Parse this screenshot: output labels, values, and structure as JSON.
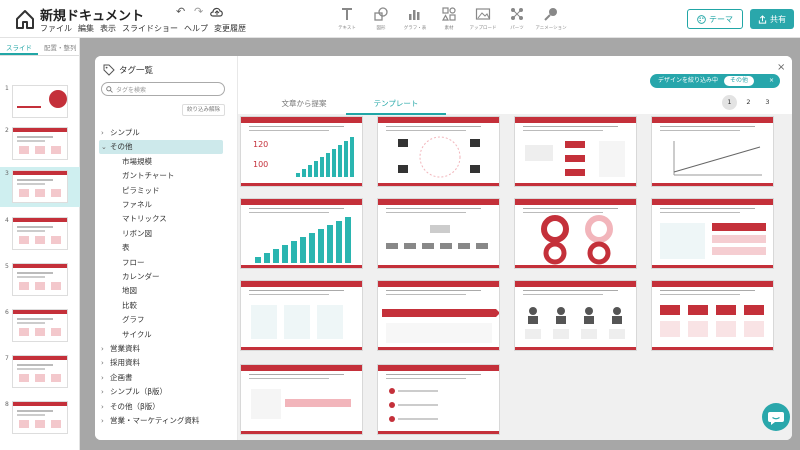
{
  "header": {
    "title": "新規ドキュメント",
    "menu": [
      "ファイル",
      "編集",
      "表示",
      "スライドショー",
      "ヘルプ",
      "変更履歴"
    ],
    "undo": "↶",
    "redo": "↷",
    "tools": [
      {
        "icon": "text-icon",
        "label": "テキスト"
      },
      {
        "icon": "shape-icon",
        "label": "図形"
      },
      {
        "icon": "chart-icon",
        "label": "グラフ・表"
      },
      {
        "icon": "material-icon",
        "label": "素材"
      },
      {
        "icon": "image-upload-icon",
        "label": "アップロード"
      },
      {
        "icon": "parts-icon",
        "label": "パーツ"
      },
      {
        "icon": "animation-icon",
        "label": "アニメーション"
      }
    ],
    "theme_label": "テーマ",
    "share_label": "共有"
  },
  "slide_pane": {
    "tabs": [
      "スライド",
      "配置・整列"
    ],
    "thumbnails": [
      "1",
      "2",
      "3",
      "4",
      "5",
      "6",
      "7",
      "8"
    ],
    "selected": "3"
  },
  "tag_panel": {
    "title": "タグ一覧",
    "search_placeholder": "タグを検索",
    "filter_button": "絞り込み解除",
    "tags": [
      {
        "label": "シンプル",
        "level": "top",
        "chev": "›"
      },
      {
        "label": "その他",
        "level": "top",
        "chev": "⌄",
        "selected": true
      },
      {
        "label": "市場規模",
        "level": "sub"
      },
      {
        "label": "ガントチャート",
        "level": "sub"
      },
      {
        "label": "ピラミッド",
        "level": "sub"
      },
      {
        "label": "ファネル",
        "level": "sub"
      },
      {
        "label": "マトリックス",
        "level": "sub"
      },
      {
        "label": "リボン図",
        "level": "sub"
      },
      {
        "label": "表",
        "level": "sub"
      },
      {
        "label": "フロー",
        "level": "sub"
      },
      {
        "label": "カレンダー",
        "level": "sub"
      },
      {
        "label": "地図",
        "level": "sub"
      },
      {
        "label": "比較",
        "level": "sub"
      },
      {
        "label": "グラフ",
        "level": "sub"
      },
      {
        "label": "サイクル",
        "level": "sub"
      },
      {
        "label": "営業資料",
        "level": "top",
        "chev": "›"
      },
      {
        "label": "採用資料",
        "level": "top",
        "chev": "›"
      },
      {
        "label": "企画書",
        "level": "top",
        "chev": "›"
      },
      {
        "label": "シンプル（β版）",
        "level": "top",
        "chev": "›"
      },
      {
        "label": "その他（β版）",
        "level": "top",
        "chev": "›"
      },
      {
        "label": "営業・マーケティング資料",
        "level": "top",
        "chev": "›"
      }
    ]
  },
  "content": {
    "tabs": [
      "文章から提案",
      "テンプレート"
    ],
    "active_tab": "テンプレート",
    "filter_chip_label": "デザインを絞り込み中",
    "filter_chip_value": "その他",
    "filter_chip_close": "×",
    "pages": [
      "1",
      "2",
      "3"
    ],
    "current_page": "1",
    "close": "×",
    "templates": [
      {
        "kind": "market-size",
        "texts": [
          "120",
          "100"
        ]
      },
      {
        "kind": "icons-cycle"
      },
      {
        "kind": "flow-boxes"
      },
      {
        "kind": "line-chart"
      },
      {
        "kind": "bar-chart"
      },
      {
        "kind": "hierarchy"
      },
      {
        "kind": "donuts"
      },
      {
        "kind": "list-panels"
      },
      {
        "kind": "process-steps"
      },
      {
        "kind": "ribbon"
      },
      {
        "kind": "people-rows"
      },
      {
        "kind": "icon-grid"
      },
      {
        "kind": "flow-arrow"
      },
      {
        "kind": "numbered-list"
      }
    ]
  },
  "colors": {
    "accent": "#21a6a6",
    "brand_red": "#c4303a",
    "overlay": "#5a5a5a"
  }
}
